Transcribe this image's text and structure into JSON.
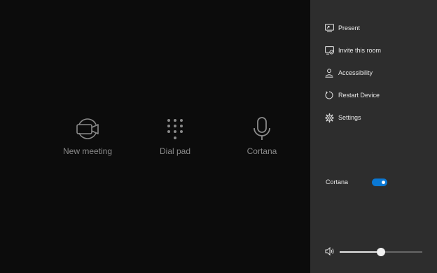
{
  "main": {
    "tiles": [
      {
        "label": "New meeting",
        "icon": "video-camera-icon"
      },
      {
        "label": "Dial pad",
        "icon": "dial-pad-icon"
      },
      {
        "label": "Cortana",
        "icon": "microphone-icon"
      }
    ]
  },
  "panel": {
    "menu": [
      {
        "label": "Present",
        "icon": "present-screen-icon"
      },
      {
        "label": "Invite this room",
        "icon": "invite-room-icon"
      },
      {
        "label": "Accessibility",
        "icon": "accessibility-icon"
      },
      {
        "label": "Restart Device",
        "icon": "restart-icon"
      },
      {
        "label": "Settings",
        "icon": "gear-icon"
      }
    ],
    "cortana_toggle": {
      "label": "Cortana",
      "on": true
    },
    "volume": {
      "level": 0.5,
      "icon": "speaker-icon"
    }
  },
  "colors": {
    "background": "#0c0c0c",
    "panel": "#2d2d2d",
    "accent": "#0a78d4",
    "tile_icon": "#8a8a8a"
  }
}
